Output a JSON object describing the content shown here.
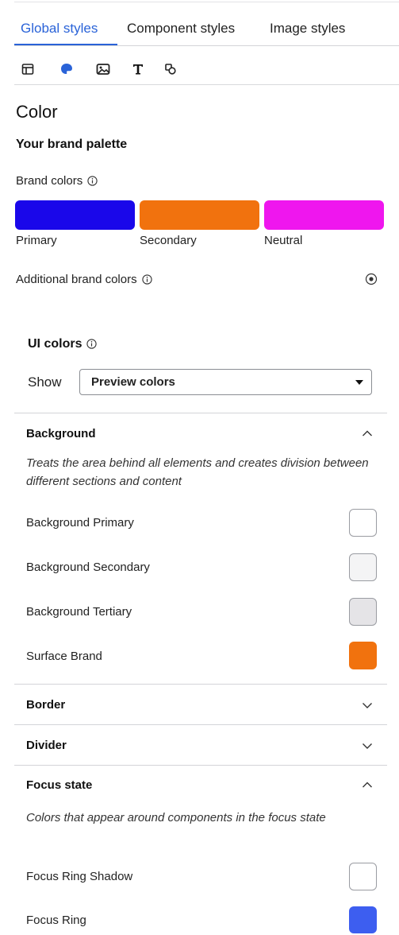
{
  "tabs": [
    {
      "label": "Global styles",
      "active": true
    },
    {
      "label": "Component styles",
      "active": false
    },
    {
      "label": "Image styles",
      "active": false
    }
  ],
  "icon_toolbar": [
    {
      "icon": "layout-icon",
      "active": false
    },
    {
      "icon": "color-palette-icon",
      "active": true
    },
    {
      "icon": "image-icon",
      "active": false
    },
    {
      "icon": "typography-icon",
      "active": false
    },
    {
      "icon": "shapes-icon",
      "active": false
    }
  ],
  "color_section": {
    "heading": "Color",
    "palette_heading": "Your brand palette",
    "brand_colors_label": "Brand colors",
    "brand_colors": [
      {
        "name": "Primary",
        "color": "#1a07ea"
      },
      {
        "name": "Secondary",
        "color": "#f1720e"
      },
      {
        "name": "Neutral",
        "color": "#ef16ee"
      }
    ],
    "additional_label": "Additional brand colors"
  },
  "ui_colors": {
    "heading": "UI colors",
    "show_label": "Show",
    "show_value": "Preview colors"
  },
  "groups": {
    "background": {
      "title": "Background",
      "expanded": true,
      "description": "Treats the area behind all elements and creates division between different sections and content",
      "items": [
        {
          "label": "Background Primary",
          "color": "#ffffff"
        },
        {
          "label": "Background Secondary",
          "color": "#f4f4f5"
        },
        {
          "label": "Background Tertiary",
          "color": "#e5e4e7"
        },
        {
          "label": "Surface Brand",
          "color": "#f1720e"
        }
      ]
    },
    "border": {
      "title": "Border",
      "expanded": false
    },
    "divider": {
      "title": "Divider",
      "expanded": false
    },
    "focus_state": {
      "title": "Focus state",
      "expanded": true,
      "description": "Colors that appear around components in the focus state",
      "items": [
        {
          "label": "Focus Ring Shadow",
          "color": "#ffffff"
        },
        {
          "label": "Focus Ring",
          "color": "#3d5ef0"
        }
      ]
    }
  }
}
